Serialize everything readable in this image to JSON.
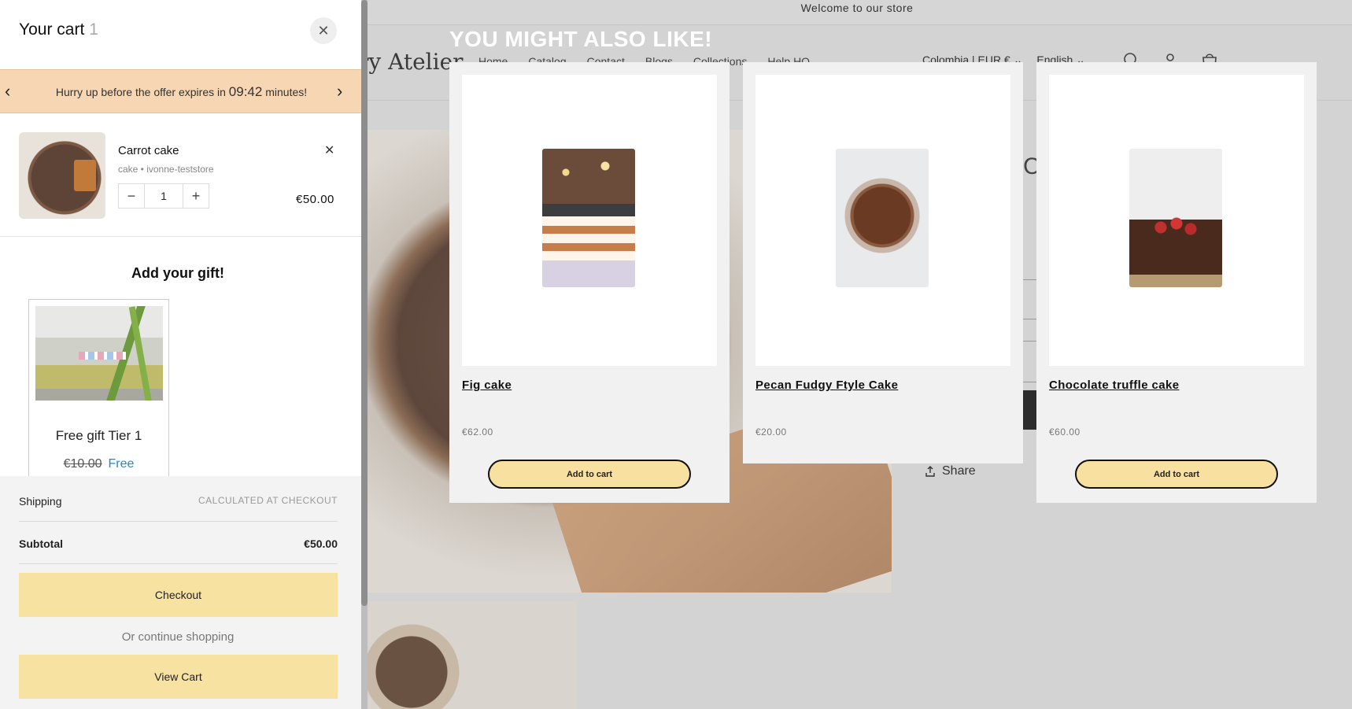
{
  "store": {
    "announcement": "Welcome to our store",
    "brand_fragment": "ry Atelier",
    "nav": [
      "Home",
      "Catalog",
      "Contact",
      "Blogs",
      "Collections",
      "Help HQ"
    ],
    "country_currency": "Colombia | EUR €",
    "language": "English",
    "share_label": "Share"
  },
  "upsell": {
    "title": "YOU MIGHT ALSO LIKE!",
    "products": [
      {
        "name": "Fig cake",
        "price": "€62.00",
        "button": "Add to cart"
      },
      {
        "name": "Pecan Fudgy Ftyle Cake",
        "price": "€20.00",
        "button": "Add to cart"
      },
      {
        "name": "Chocolate truffle cake",
        "price": "€60.00",
        "button": "Add to cart"
      }
    ]
  },
  "cart": {
    "title": "Your cart",
    "count": "1",
    "close_icon": "close-icon",
    "offer": {
      "prefix": "Hurry up before the offer expires in",
      "timer": "09:42",
      "suffix": "minutes!"
    },
    "item": {
      "name": "Carrot cake",
      "meta": "cake • ivonne-teststore",
      "quantity": "1",
      "price": "€50.00"
    },
    "gift": {
      "heading": "Add your gift!",
      "name": "Free gift Tier 1",
      "old_price": "€10.00",
      "new_price": "Free"
    },
    "footer": {
      "shipping_label": "Shipping",
      "shipping_value": "CALCULATED AT CHECKOUT",
      "subtotal_label": "Subtotal",
      "subtotal_value": "€50.00",
      "checkout": "Checkout",
      "continue": "Or continue shopping",
      "view_cart": "View Cart"
    }
  },
  "colors": {
    "offer_bg": "#f7d6b4",
    "button_bg": "#f8e2a2",
    "free_text": "#2a86c9"
  }
}
